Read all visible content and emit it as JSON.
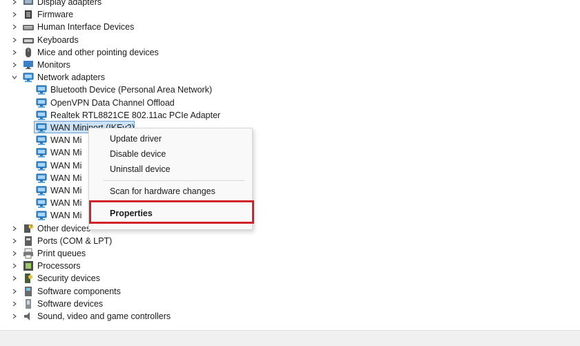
{
  "tree": {
    "rows": [
      {
        "label": "Display adapters",
        "icon": "display-adapter-icon"
      },
      {
        "label": "Firmware",
        "icon": "firmware-icon"
      },
      {
        "label": "Human Interface Devices",
        "icon": "hid-icon"
      },
      {
        "label": "Keyboards",
        "icon": "keyboard-icon"
      },
      {
        "label": "Mice and other pointing devices",
        "icon": "mouse-icon"
      },
      {
        "label": "Monitors",
        "icon": "monitor-icon"
      },
      {
        "label": "Network adapters",
        "icon": "network-adapter-icon"
      },
      {
        "label": "Bluetooth Device (Personal Area Network)",
        "icon": "network-adapter-icon"
      },
      {
        "label": "OpenVPN Data Channel Offload",
        "icon": "network-adapter-icon"
      },
      {
        "label": "Realtek RTL8821CE 802.11ac PCIe Adapter",
        "icon": "network-adapter-icon"
      },
      {
        "label": "WAN Miniport (IKEv2)",
        "icon": "network-adapter-icon"
      },
      {
        "label": "WAN Mi",
        "icon": "network-adapter-icon"
      },
      {
        "label": "WAN Mi",
        "icon": "network-adapter-icon"
      },
      {
        "label": "WAN Mi",
        "icon": "network-adapter-icon"
      },
      {
        "label": "WAN Mi",
        "icon": "network-adapter-icon"
      },
      {
        "label": "WAN Mi",
        "icon": "network-adapter-icon"
      },
      {
        "label": "WAN Mi",
        "icon": "network-adapter-icon"
      },
      {
        "label": "WAN Mi",
        "icon": "network-adapter-icon"
      },
      {
        "label": "Other devices",
        "icon": "other-devices-icon"
      },
      {
        "label": "Ports (COM & LPT)",
        "icon": "port-icon"
      },
      {
        "label": "Print queues",
        "icon": "printer-icon"
      },
      {
        "label": "Processors",
        "icon": "processor-icon"
      },
      {
        "label": "Security devices",
        "icon": "security-device-icon"
      },
      {
        "label": "Software components",
        "icon": "software-component-icon"
      },
      {
        "label": "Software devices",
        "icon": "software-device-icon"
      },
      {
        "label": "Sound, video and game controllers",
        "icon": "speaker-icon"
      }
    ]
  },
  "context_menu": {
    "update_driver": "Update driver",
    "disable_device": "Disable device",
    "uninstall_device": "Uninstall device",
    "scan_hardware": "Scan for hardware changes",
    "properties": "Properties"
  },
  "colors": {
    "selection": "#cce3f7",
    "highlight_box": "#d3232a"
  }
}
